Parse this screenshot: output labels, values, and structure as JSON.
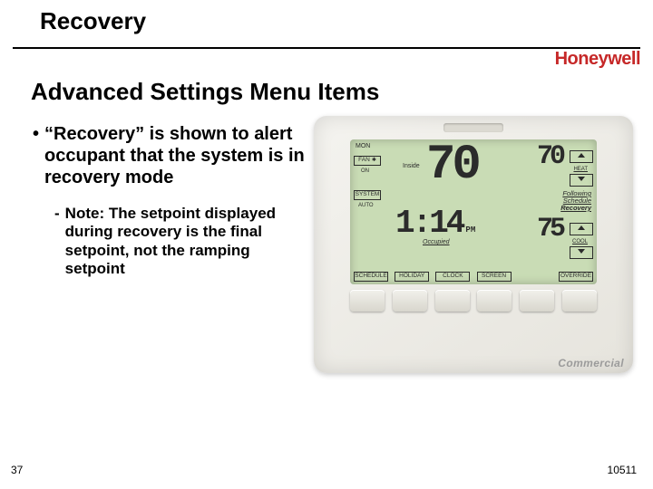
{
  "header": {
    "title": "Recovery",
    "brand": "Honeywell"
  },
  "subtitle": "Advanced Settings Menu Items",
  "bullets": {
    "b1": "“Recovery” is shown to alert occupant that the system is in recovery mode",
    "b2": "Note: The setpoint displayed during recovery is the final setpoint, not the ramping setpoint"
  },
  "thermostat": {
    "day": "MON",
    "fan_label": "FAN",
    "fan_state": "ON",
    "system_label": "SYSTEM",
    "system_state": "AUTO",
    "inside_label": "Inside",
    "inside_temp": "70",
    "time": "1:14",
    "time_suffix": "PM",
    "occupied": "Occupied",
    "heat_setpoint": "70",
    "heat_label": "HEAT",
    "cool_setpoint": "75",
    "cool_label": "COOL",
    "status_line1": "Following",
    "status_line2": "Schedule",
    "status_line3": "Recovery",
    "buttons": [
      "SCHEDULE",
      "HOLIDAY",
      "CLOCK",
      "SCREEN",
      "",
      "OVERRIDE"
    ]
  },
  "commercial": "Commercial",
  "footer": {
    "page": "37",
    "code": "10511"
  }
}
